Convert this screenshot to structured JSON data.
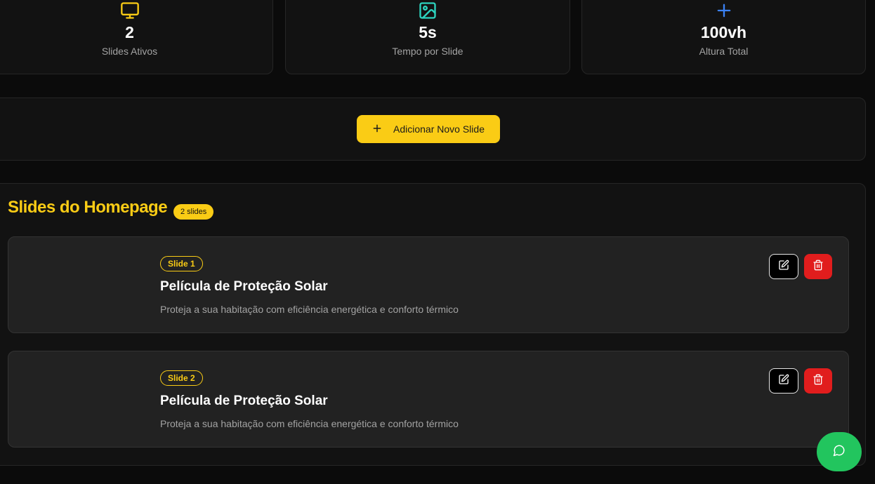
{
  "stats": [
    {
      "value": "2",
      "label": "Slides Ativos",
      "icon": "monitor-icon",
      "color": "#facc15"
    },
    {
      "value": "5s",
      "label": "Tempo por Slide",
      "icon": "image-icon",
      "color": "#2dd4bf"
    },
    {
      "value": "100vh",
      "label": "Altura Total",
      "icon": "plus-icon",
      "color": "#3b82f6"
    }
  ],
  "add_button": {
    "label": "Adicionar Novo Slide",
    "icon": "plus-icon"
  },
  "slides_panel": {
    "title": "Slides do Homepage",
    "count_badge": "2 slides",
    "slides": [
      {
        "tag": "Slide 1",
        "title": "Película de Proteção Solar",
        "description": "Proteja a sua habitação com eficiência energética e conforto térmico"
      },
      {
        "tag": "Slide 2",
        "title": "Película de Proteção Solar",
        "description": "Proteja a sua habitação com eficiência energética e conforto térmico"
      }
    ]
  },
  "colors": {
    "accent": "#facc15",
    "danger": "#e11d1d",
    "chat": "#22c55e"
  },
  "chat_button": {
    "icon": "chat-bubble-icon"
  }
}
